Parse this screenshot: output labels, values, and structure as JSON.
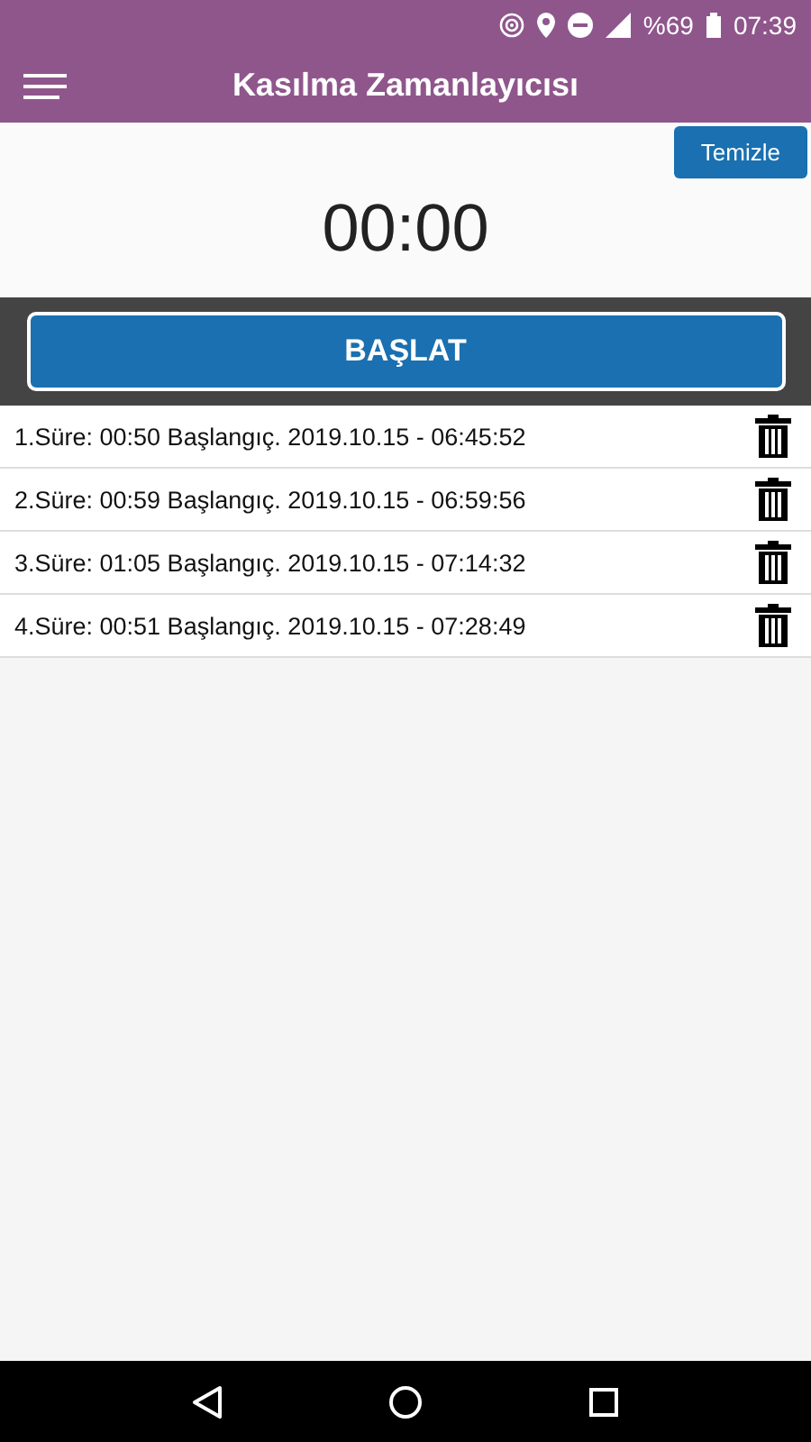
{
  "status_bar": {
    "battery": "%69",
    "time": "07:39"
  },
  "app_bar": {
    "title": "Kasılma Zamanlayıcısı"
  },
  "clear_button": "Temizle",
  "timer": "00:00",
  "start_button": "BAŞLAT",
  "entries": [
    {
      "text": "1.Süre: 00:50 Başlangıç. 2019.10.15 - 06:45:52"
    },
    {
      "text": "2.Süre: 00:59 Başlangıç. 2019.10.15 - 06:59:56"
    },
    {
      "text": "3.Süre: 01:05 Başlangıç. 2019.10.15 - 07:14:32"
    },
    {
      "text": "4.Süre: 00:51 Başlangıç. 2019.10.15 - 07:28:49"
    }
  ]
}
